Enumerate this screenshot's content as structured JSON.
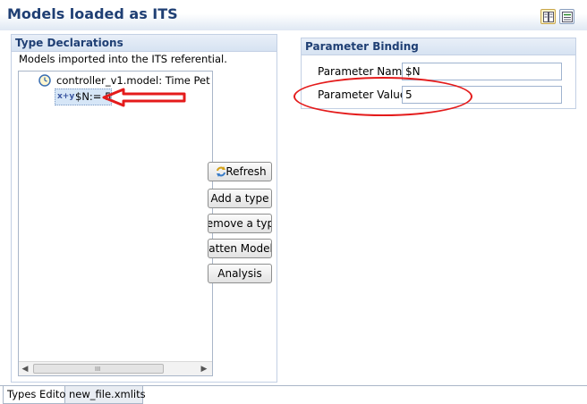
{
  "header": {
    "title": "Models loaded as ITS"
  },
  "types": {
    "title": "Type Declarations",
    "description": "Models imported into the ITS referential.",
    "tree": {
      "root_label": "controller_v1.model: Time Pet",
      "child_icon_text": "x+y",
      "child_label": "$N:= 5"
    }
  },
  "buttons": {
    "refresh": "Refresh",
    "add_type": "Add a type",
    "remove_type": "Remove a type",
    "flatten": "Flatten Model",
    "analysis": "Analysis"
  },
  "params": {
    "title": "Parameter Binding",
    "name_label": "Parameter Name",
    "name_value": "$N",
    "value_label": "Parameter Value",
    "value_value": "5"
  },
  "scrollbar": {
    "grip": "III"
  },
  "tabs": [
    {
      "label": "Types Editor",
      "active": true
    },
    {
      "label": "new_file.xmlits",
      "active": false
    }
  ],
  "colors": {
    "accent": "#1f3f74",
    "annotation": "#e41b1b"
  }
}
